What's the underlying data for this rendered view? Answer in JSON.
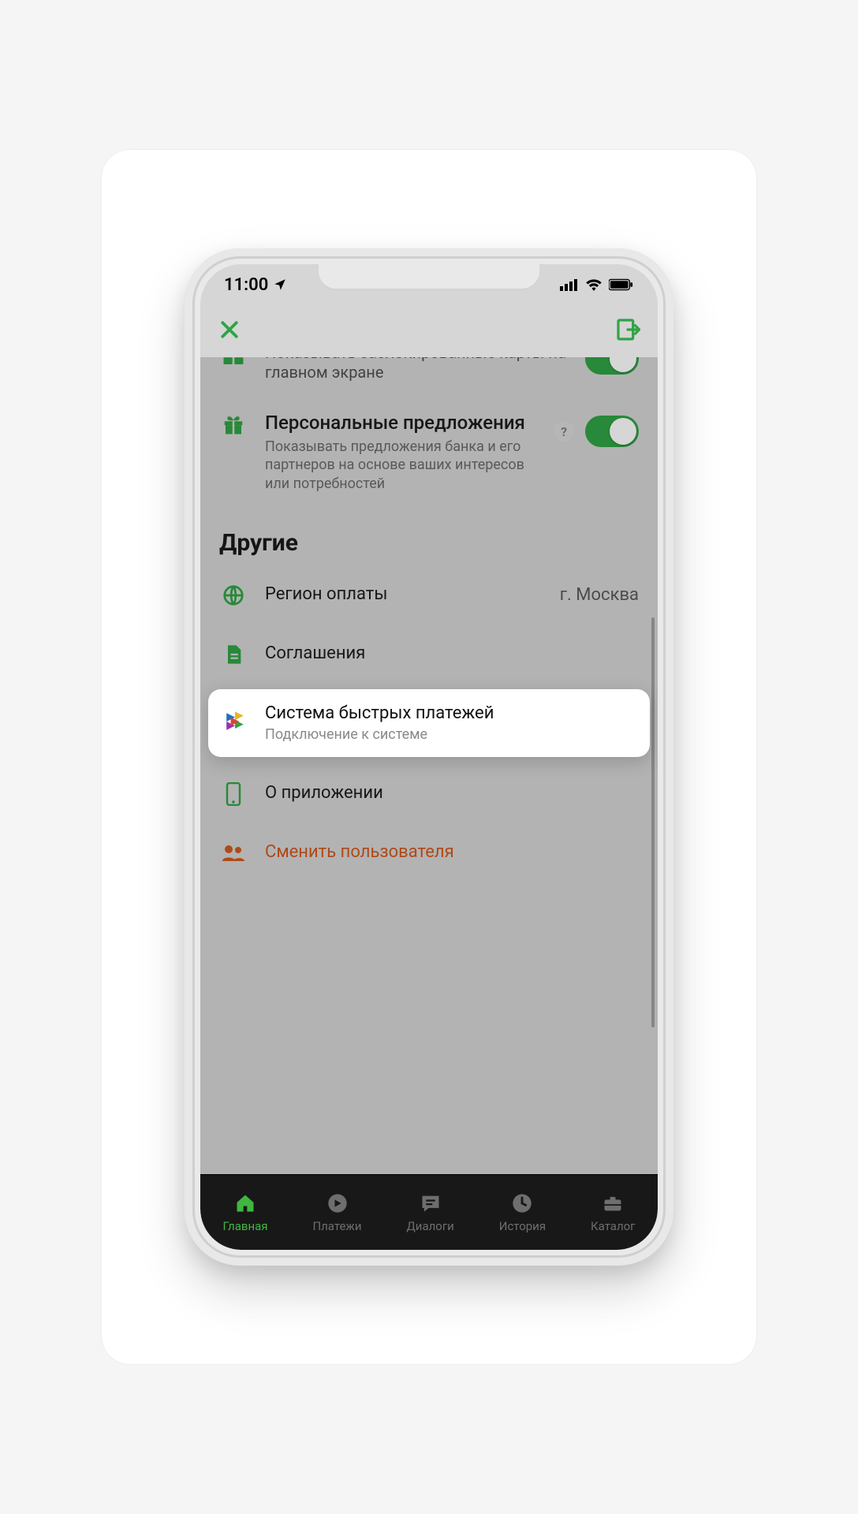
{
  "status": {
    "time": "11:00"
  },
  "settings": {
    "item1": {
      "title": "Показывать заблокированные карты на главном экране",
      "on": true
    },
    "item2": {
      "title": "Персональные предложения",
      "desc": "Показывать предложения банка и его партнеров на основе ваших интересов или потребностей",
      "help": "?",
      "on": true
    }
  },
  "section_other": "Другие",
  "other": {
    "region": {
      "label": "Регион оплаты",
      "value": "г. Москва"
    },
    "agreements": {
      "label": "Соглашения"
    },
    "sbp": {
      "label": "Система быстрых платежей",
      "sub": "Подключение к системе"
    },
    "about": {
      "label": "О приложении"
    },
    "switch_user": {
      "label": "Сменить пользователя"
    }
  },
  "tabs": {
    "home": "Главная",
    "payments": "Платежи",
    "dialogs": "Диалоги",
    "history": "История",
    "catalog": "Каталог"
  }
}
